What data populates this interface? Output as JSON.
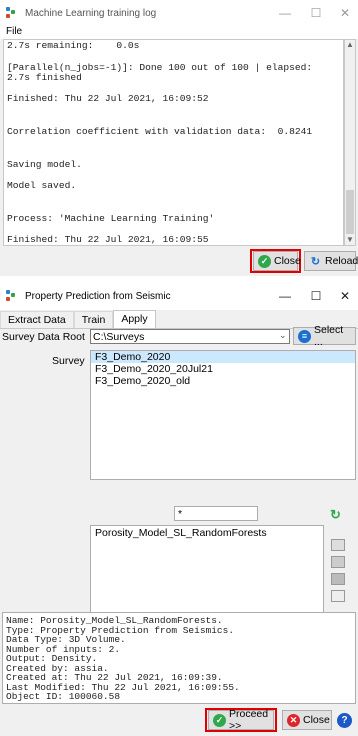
{
  "log_window": {
    "title": "Machine Learning training log",
    "menu": [
      "File"
    ],
    "lines": [
      "2.7s remaining:    0.0s",
      "[Parallel(n_jobs=-1)]: Done 100 out of 100 | elapsed:",
      "2.7s finished",
      "Finished: Thu 22 Jul 2021, 16:09:52",
      "Correlation coefficient with validation data:  0.8241",
      "Saving model.",
      "Model saved.",
      "Process: 'Machine Learning Training'",
      "Finished: Thu 22 Jul 2021, 16:09:55"
    ],
    "buttons": {
      "close": "Close",
      "reload": "Reload"
    }
  },
  "prediction_window": {
    "title": "Property Prediction from Seismic",
    "tabs": [
      "Extract Data",
      "Train",
      "Apply"
    ],
    "active_tab": "Apply",
    "survey_root_label": "Survey Data Root",
    "survey_root_value": "C:\\Surveys",
    "select_button": "Select ...",
    "survey_label": "Survey",
    "surveys": [
      "F3_Demo_2020",
      "F3_Demo_2020_20Jul21",
      "F3_Demo_2020_old"
    ],
    "selected_survey": "F3_Demo_2020",
    "filter_value": "*",
    "models": [
      "Porosity_Model_SL_RandomForests"
    ],
    "info_lines": [
      "Name: Porosity_Model_SL_RandomForests.",
      "Type: Property Prediction from Seismics.",
      "Data Type: 3D Volume.",
      "Number of inputs: 2.",
      "Output: Density.",
      "Created by: assia.",
      "Created at: Thu 22 Jul 2021, 16:09:39.",
      "Last Modified: Thu 22 Jul 2021, 16:09:55.",
      "Object ID: 100060.58"
    ],
    "buttons": {
      "proceed": "Proceed >>",
      "close": "Close",
      "help": "?"
    }
  },
  "window_controls": {
    "minimize": "—",
    "maximize": "☐",
    "close": "✕"
  },
  "colors": {
    "highlight": "#e00000",
    "close_green": "#2ea84a",
    "reload_blue": "#1a6fd0",
    "close_red": "#e0242b",
    "help_blue": "#1b58c8"
  }
}
